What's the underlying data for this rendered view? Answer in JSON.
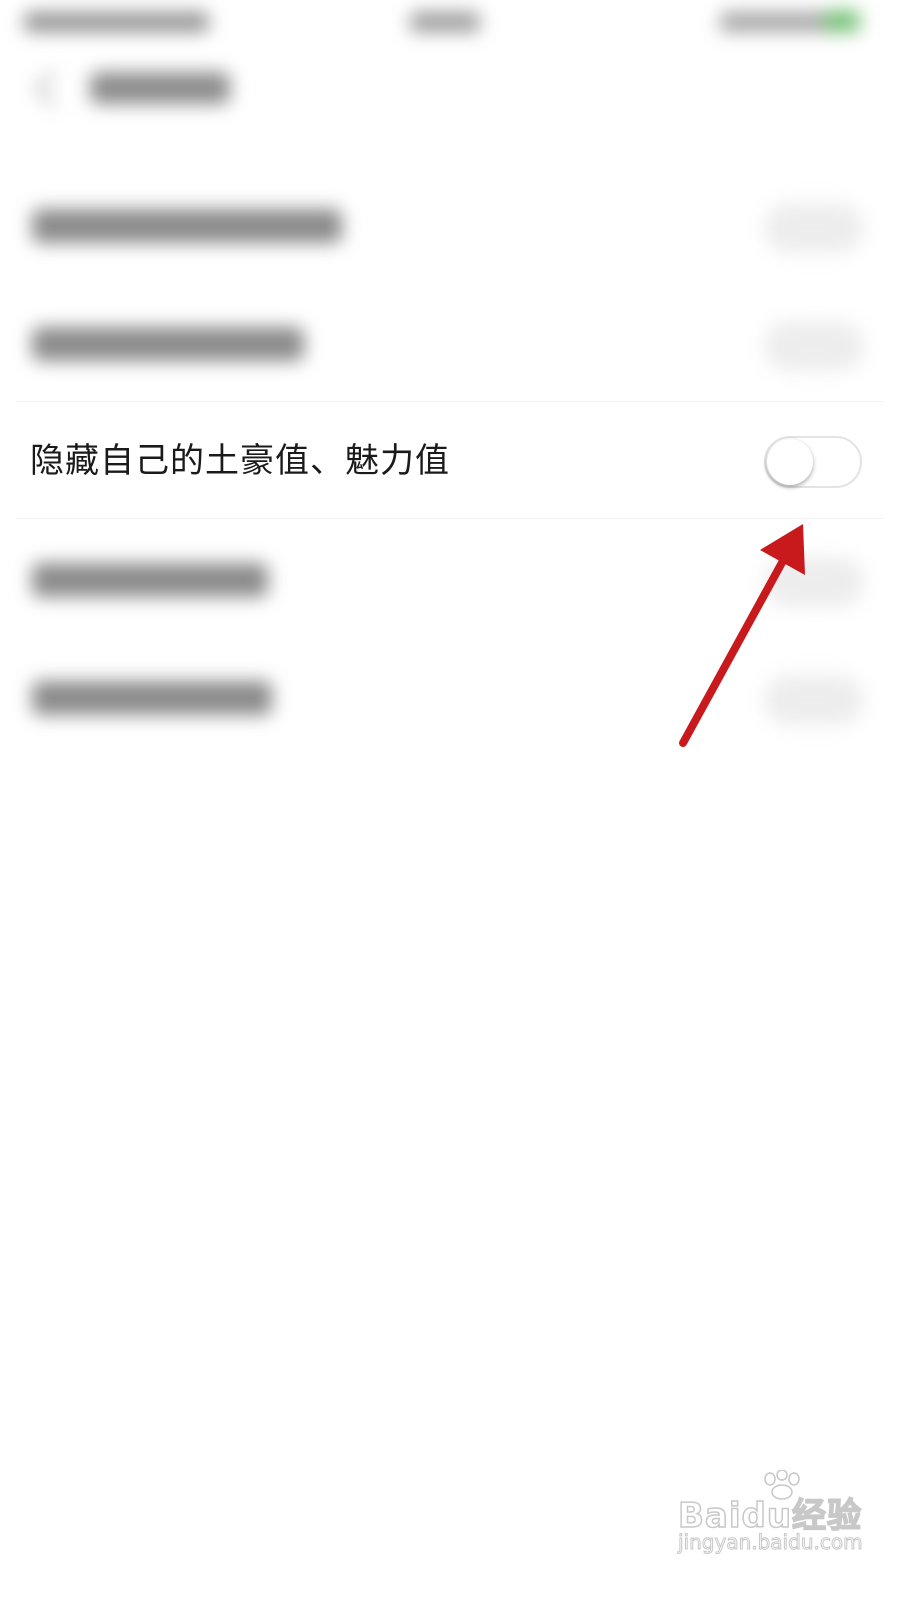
{
  "setting": {
    "label": "隐藏自己的土豪值、魅力值",
    "toggle_on": false
  },
  "annotation": {
    "arrow_color": "#c8191c"
  },
  "watermark": {
    "brand": "Baidu经验",
    "url": "jingyan.baidu.com"
  },
  "colors": {
    "background": "#ffffff",
    "toggle_border": "#e3e3e3",
    "text": "#1a1a1a"
  }
}
